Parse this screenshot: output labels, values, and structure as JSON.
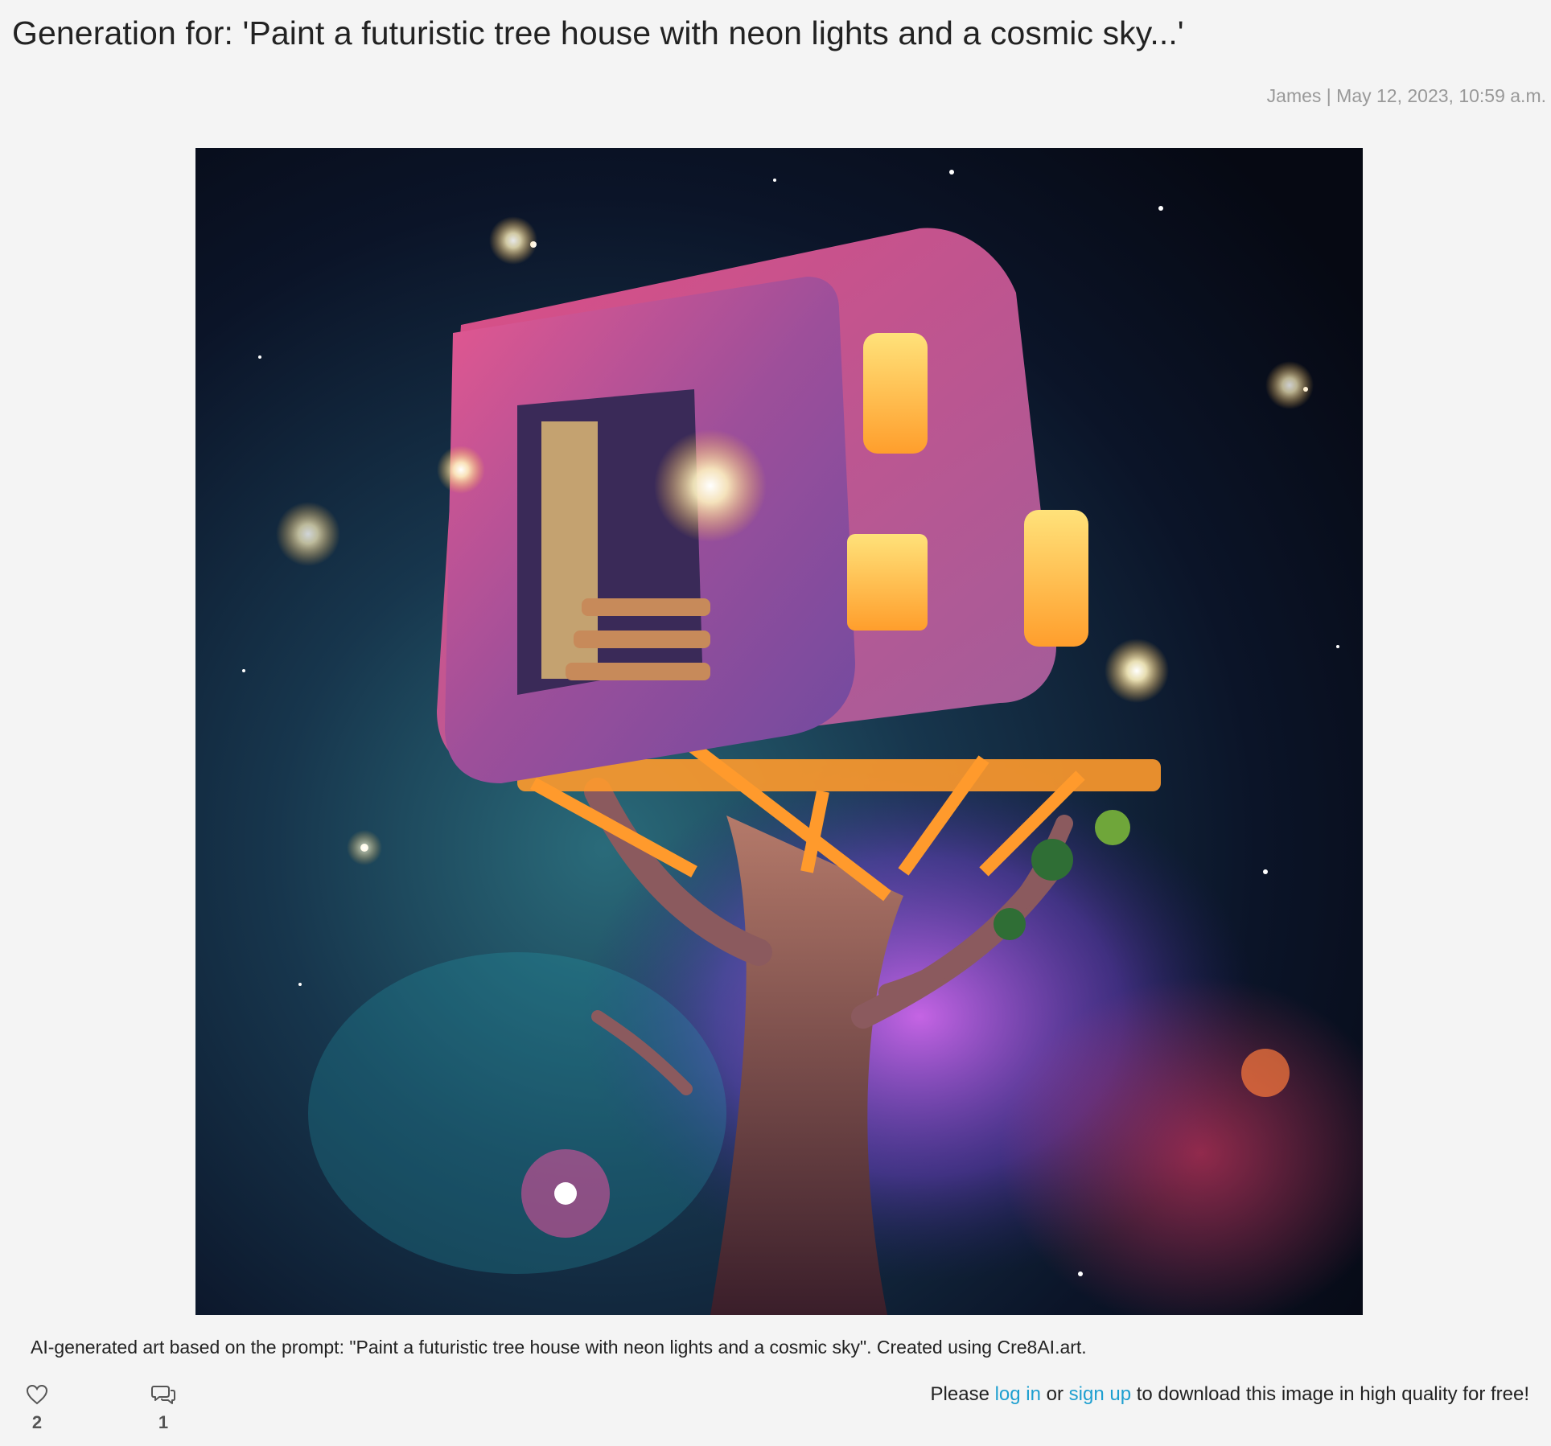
{
  "page": {
    "title": "Generation for: 'Paint a futuristic tree house with neon lights and a cosmic sky...'",
    "meta": "James | May 12, 2023, 10:59 a.m.",
    "caption": "AI-generated art based on the prompt: \"Paint a futuristic tree house with neon lights and a cosmic sky\". Created using Cre8AI.art."
  },
  "artwork": {
    "description_icon": "ai-generated-image"
  },
  "stats": {
    "likes": "2",
    "comments": "1",
    "like_icon": "heart-icon",
    "comment_icon": "speech-bubbles-icon"
  },
  "download": {
    "prefix": "Please ",
    "login_label": "log in",
    "middle": " or ",
    "signup_label": "sign up",
    "suffix": " to download this image in high quality for free!",
    "link_color": "#1e9fd0"
  }
}
